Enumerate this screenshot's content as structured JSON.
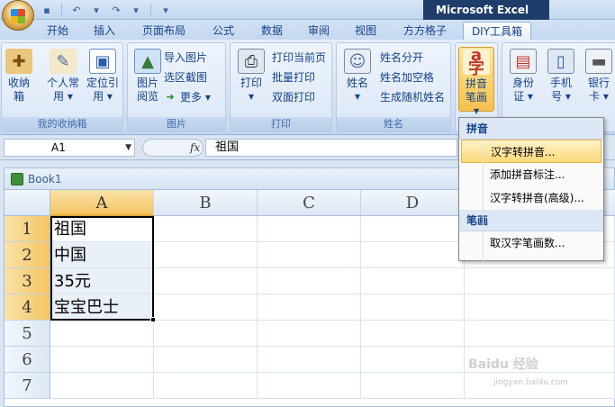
{
  "app": {
    "title": "Microsoft Excel"
  },
  "qat": {
    "icons": [
      "save-icon",
      "undo-icon",
      "redo-icon",
      "customize-icon"
    ]
  },
  "tabs": [
    {
      "label": "开始"
    },
    {
      "label": "插入"
    },
    {
      "label": "页面布局"
    },
    {
      "label": "公式"
    },
    {
      "label": "数据"
    },
    {
      "label": "审阅"
    },
    {
      "label": "视图"
    },
    {
      "label": "方方格子"
    },
    {
      "label": "DIY工具箱",
      "active": true
    }
  ],
  "ribbon": {
    "groups": [
      {
        "label": "我的收纳箱",
        "buttons": [
          {
            "label": "收纳箱"
          },
          {
            "label": "个人常用 ▾"
          },
          {
            "label": "定位引用 ▾"
          }
        ]
      },
      {
        "label": "图片",
        "buttons": [
          {
            "label": "图片阅览"
          }
        ],
        "small": [
          {
            "label": "导入图片"
          },
          {
            "label": "选区截图"
          },
          {
            "label": "更多 ▾"
          }
        ]
      },
      {
        "label": "打印",
        "buttons": [
          {
            "label": "打印 ▾"
          }
        ],
        "small": [
          {
            "label": "打印当前页"
          },
          {
            "label": "批量打印"
          },
          {
            "label": "双面打印"
          }
        ]
      },
      {
        "label": "姓名",
        "buttons": [
          {
            "label": "姓名 ▾"
          }
        ],
        "small": [
          {
            "label": "姓名分开"
          },
          {
            "label": "姓名加空格"
          },
          {
            "label": "生成随机姓名"
          }
        ]
      },
      {
        "buttons": [
          {
            "label": "拼音笔画 ▾"
          }
        ]
      },
      {
        "buttons": [
          {
            "label": "身份证 ▾"
          },
          {
            "label": "手机号 ▾"
          },
          {
            "label": "银行卡 ▾"
          }
        ]
      }
    ]
  },
  "formula_bar": {
    "name_box": "A1",
    "fx": "fx",
    "value": "祖国"
  },
  "workbook": {
    "title": "Book1",
    "columns": [
      "A",
      "B",
      "C",
      "D"
    ],
    "rows": [
      "1",
      "2",
      "3",
      "4",
      "5",
      "6",
      "7"
    ],
    "cells_A": [
      "祖国",
      "中国",
      "35元",
      "宝宝巴士"
    ]
  },
  "menu": {
    "sections": [
      {
        "header": "拼音",
        "items": [
          "汉字转拼音...",
          "添加拼音标注...",
          "汉字转拼音(高级)..."
        ]
      },
      {
        "header": "笔画",
        "items": [
          "取汉字笔画数..."
        ]
      }
    ]
  },
  "watermark": {
    "brand": "Baidu 经验",
    "url": "jingyan.baidu.com"
  }
}
